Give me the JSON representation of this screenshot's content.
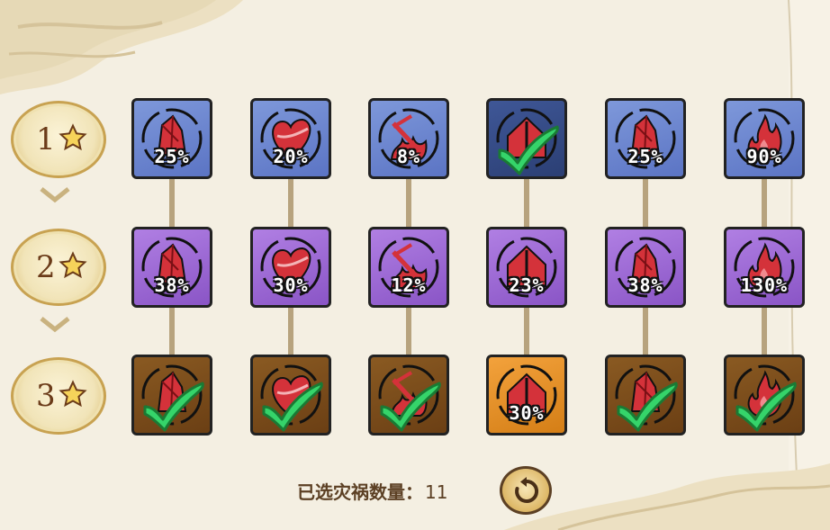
{
  "rows": [
    {
      "level": "1",
      "tiles": [
        {
          "icon": "crystal-icon",
          "pct": "25%",
          "selected": false,
          "style": "blue"
        },
        {
          "icon": "heart-icon",
          "pct": "20%",
          "selected": false,
          "style": "blue"
        },
        {
          "icon": "sword-fire-icon",
          "pct": "8%",
          "selected": false,
          "style": "blue"
        },
        {
          "icon": "shield-house-icon",
          "pct": "",
          "selected": true,
          "style": "blue-dim"
        },
        {
          "icon": "crystal-icon",
          "pct": "25%",
          "selected": false,
          "style": "blue"
        },
        {
          "icon": "flame-icon",
          "pct": "90%",
          "selected": false,
          "style": "blue"
        }
      ]
    },
    {
      "level": "2",
      "tiles": [
        {
          "icon": "crystal-icon",
          "pct": "38%",
          "selected": false,
          "style": "purple"
        },
        {
          "icon": "heart-icon",
          "pct": "30%",
          "selected": false,
          "style": "purple"
        },
        {
          "icon": "sword-fire-icon",
          "pct": "12%",
          "selected": false,
          "style": "purple"
        },
        {
          "icon": "shield-house-icon",
          "pct": "23%",
          "selected": false,
          "style": "purple"
        },
        {
          "icon": "crystal-icon",
          "pct": "38%",
          "selected": false,
          "style": "purple"
        },
        {
          "icon": "flame-icon",
          "pct": "130%",
          "selected": false,
          "style": "purple"
        }
      ]
    },
    {
      "level": "3",
      "tiles": [
        {
          "icon": "crystal-icon",
          "pct": "",
          "selected": true,
          "style": "brown"
        },
        {
          "icon": "heart-icon",
          "pct": "",
          "selected": true,
          "style": "brown"
        },
        {
          "icon": "sword-fire-icon",
          "pct": "",
          "selected": true,
          "style": "brown"
        },
        {
          "icon": "shield-house-icon",
          "pct": "30%",
          "selected": false,
          "style": "orange"
        },
        {
          "icon": "crystal-icon",
          "pct": "",
          "selected": true,
          "style": "brown"
        },
        {
          "icon": "flame-icon",
          "pct": "",
          "selected": true,
          "style": "brown"
        }
      ]
    }
  ],
  "footer": {
    "label": "已选灾祸数量：",
    "count": "11",
    "reset_icon": "reset-icon"
  },
  "colors": {
    "check": "#35d46a",
    "icon_red": "#d4323a",
    "brown_text": "#5c4024"
  }
}
